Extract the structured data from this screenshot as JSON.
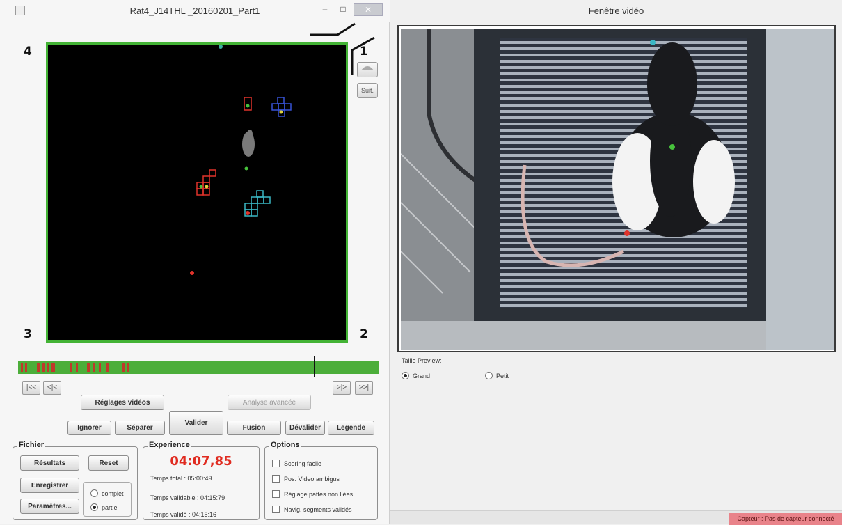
{
  "left_window": {
    "title": "Rat4_J14THL _20160201_Part1",
    "minimize_glyph": "–",
    "maximize_glyph": "□",
    "close_glyph": "✕",
    "corners": {
      "top_left": "4",
      "top_right": "1",
      "bottom_left": "3",
      "bottom_right": "2"
    },
    "side_buttons": {
      "top_label": "",
      "bottom_label": "Suit."
    },
    "nav": {
      "first": "|<<",
      "prev": "<|<",
      "next": ">|>",
      "last": ">>|"
    },
    "buttons": {
      "reglages": "Réglages vidéos",
      "analyse": "Analyse avancée",
      "ignorer": "Ignorer",
      "separer": "Séparer",
      "valider": "Valider",
      "fusion": "Fusion",
      "devalider": "Dévalider",
      "legende": "Legende"
    },
    "fichier": {
      "label": "Fichier",
      "resultats": "Résultats",
      "reset": "Reset",
      "enregistrer": "Enregistrer",
      "parametres": "Paramètres...",
      "radio_complet": "complet",
      "radio_partiel": "partiel",
      "selected": "partiel"
    },
    "experience": {
      "label": "Experience",
      "timer": "04:07,85",
      "timer_color": "#e02b20",
      "temps_total": "Temps total : 05:00:49",
      "temps_validable": "Temps validable : 04:15:79",
      "temps_valide": "Temps validé : 04:15:16"
    },
    "options": {
      "label": "Options",
      "items": [
        "Scoring facile",
        "Pos. Video ambigus",
        "Réglage pattes non liées",
        "Navig. segments validés"
      ]
    },
    "colors": {
      "arena_border": "#43b335",
      "timeline": "#4cae3a",
      "timeline_marks": "#c0392b"
    }
  },
  "right_window": {
    "title": "Fenêtre vidéo",
    "preview_label": "Taille Preview:",
    "radio_grand": "Grand",
    "radio_petit": "Petit",
    "selected": "Grand",
    "status": "Capteur : Pas de capteur connecté",
    "status_color": "#e9838a"
  }
}
